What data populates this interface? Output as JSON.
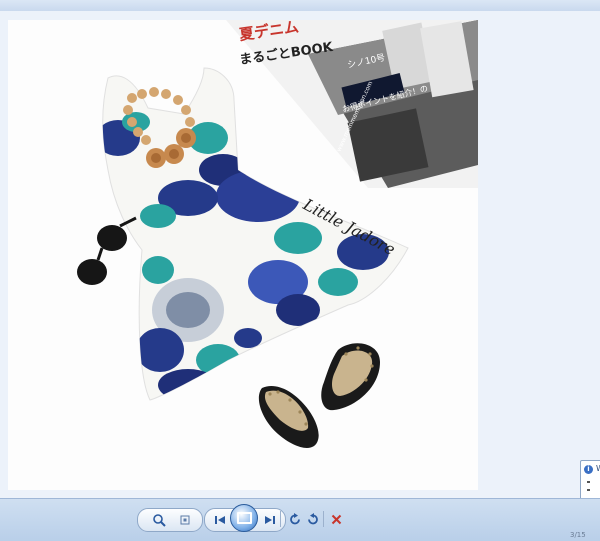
{
  "photo": {
    "magazine": {
      "headline_red": "夏デニム",
      "headline_black": "まるごとBOOK",
      "side_text_1": "シノ10号",
      "side_text_2": "お得ポイントを紹介！の",
      "url": "www.mommemotion.com"
    },
    "watermark": "Little Jadore"
  },
  "toolbar": {
    "zoom_icon": "magnifier-icon",
    "fit_icon": "actual-size-icon",
    "prev_icon": "previous-icon",
    "slideshow_icon": "play-slideshow-icon",
    "next_icon": "next-icon",
    "rotate_ccw_icon": "rotate-counterclockwise-icon",
    "rotate_cw_icon": "rotate-clockwise-icon",
    "delete_icon": "delete-icon"
  },
  "popup": {
    "title": "W"
  },
  "tray": {
    "text": "3/15"
  },
  "colors": {
    "toolbar": "#c5d7ee",
    "accent": "#2c68b8",
    "delete": "#c8352c",
    "dress_navy": "#253a8a",
    "dress_teal": "#2aa3a0"
  }
}
